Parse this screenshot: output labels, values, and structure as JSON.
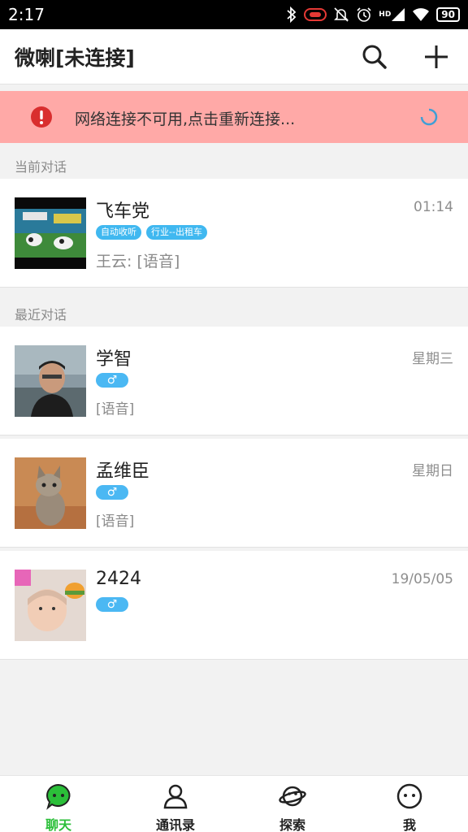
{
  "status_bar": {
    "time": "2:17",
    "hd_label": "HD",
    "battery": "90"
  },
  "header": {
    "title": "微喇[未连接]",
    "icons": [
      "search-icon",
      "add-icon"
    ]
  },
  "banner": {
    "text": "网络连接不可用,点击重新连接...",
    "color": "#ffa9a7",
    "icon": "warning-icon"
  },
  "sections": {
    "current": "当前对话",
    "recent": "最近对话"
  },
  "current_chat": {
    "name": "飞车党",
    "time": "01:14",
    "tags": [
      "自动收听",
      "行业--出租车"
    ],
    "last_message": "王云: [语音]"
  },
  "recent_chats": [
    {
      "name": "学智",
      "time": "星期三",
      "gender": "♂",
      "last_message": "[语音]"
    },
    {
      "name": "孟维臣",
      "time": "星期日",
      "gender": "♂",
      "last_message": "[语音]"
    },
    {
      "name": "2424",
      "time": "19/05/05",
      "gender": "♂",
      "last_message": ""
    }
  ],
  "tabs": [
    {
      "label": "聊天",
      "icon": "chat-icon",
      "active": true
    },
    {
      "label": "通讯录",
      "icon": "contacts-icon",
      "active": false
    },
    {
      "label": "探索",
      "icon": "planet-icon",
      "active": false
    },
    {
      "label": "我",
      "icon": "face-icon",
      "active": false
    }
  ],
  "colors": {
    "accent": "#2bbf39",
    "tag": "#40b8f0",
    "banner": "#ffa9a7"
  }
}
